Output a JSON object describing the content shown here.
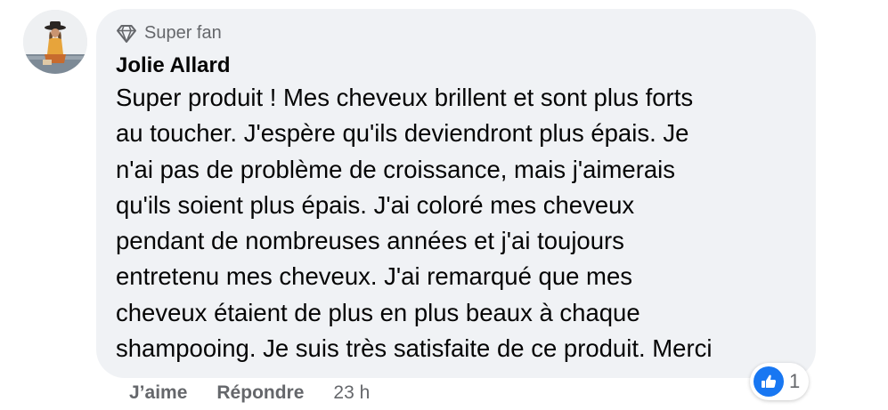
{
  "comment": {
    "badge": {
      "icon": "diamond-icon",
      "label": "Super fan"
    },
    "author": "Jolie Allard",
    "body_lines": [
      "Super produit ! Mes cheveux brillent et sont plus forts",
      "au toucher. J'espère qu'ils deviendront plus épais. Je",
      "n'ai pas de problème de croissance, mais j'aimerais",
      "qu'ils soient plus épais. J'ai coloré mes cheveux",
      "pendant de nombreuses années et j'ai toujours",
      "entretenu mes cheveux. J'ai remarqué que mes",
      "cheveux étaient de plus en plus beaux à chaque",
      "shampooing. Je suis très satisfaite de ce produit. Merci"
    ],
    "reactions": {
      "icon": "like-icon",
      "count": "1"
    },
    "actions": {
      "like": "J’aime",
      "reply": "Répondre",
      "time": "23 h"
    }
  },
  "colors": {
    "bubble_bg": "#f0f2f5",
    "text": "#050505",
    "secondary_text": "#65676b",
    "like_blue": "#1877f2"
  }
}
